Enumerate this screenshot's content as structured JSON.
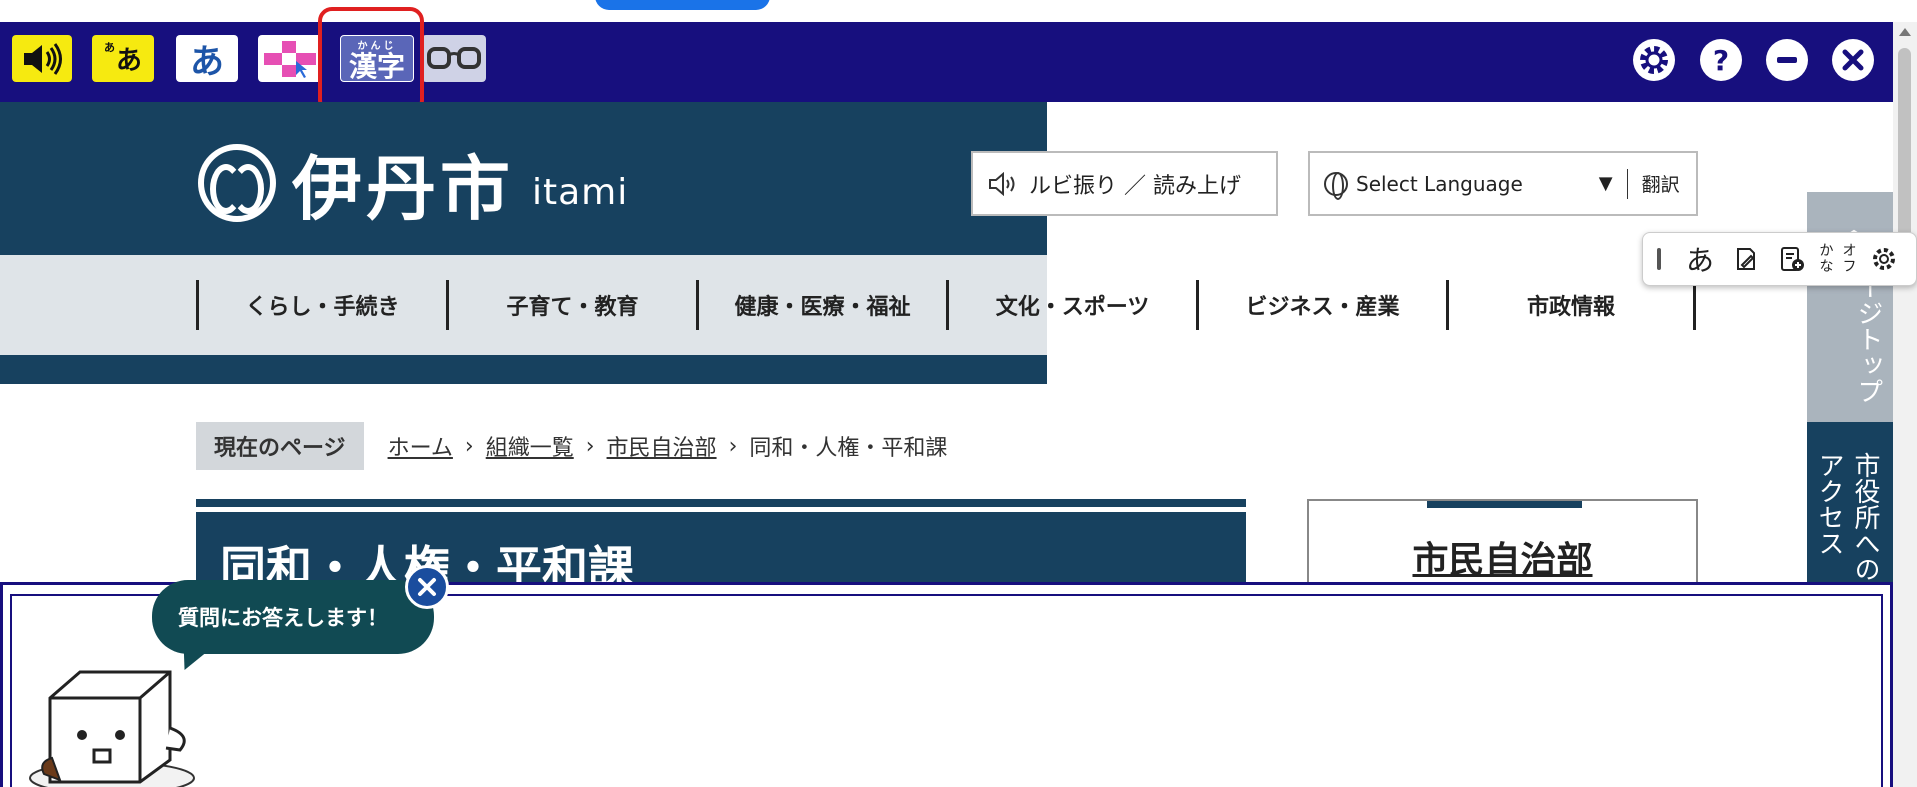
{
  "a11y_toolbar": {
    "ruby_tool": {
      "small": "あ",
      "main": "あ"
    },
    "kana_tool": "あ",
    "kanji_tool": {
      "ruby": "かんじ",
      "main": "漢字"
    },
    "help_label": "?",
    "colors": {
      "bar": "#170f7e",
      "tool_yellow": "#f6ea10",
      "highlight": "#e02020"
    }
  },
  "site": {
    "logo_text": "伊丹市",
    "logo_roman": "itami",
    "ruby_button_label": "ルビ振り ／ 読み上げ",
    "language_select": {
      "label": "Select Language",
      "translate": "翻訳"
    },
    "nav": [
      {
        "label": "くらし・手続き"
      },
      {
        "label": "子育て・教育"
      },
      {
        "label": "健康・医療・福祉"
      },
      {
        "label": "文化・スポーツ"
      },
      {
        "label": "ビジネス・産業"
      },
      {
        "label": "市政情報"
      }
    ],
    "pagetop_label": "ページトップへ",
    "access_label": "市役所へのアクセス"
  },
  "ime_toolbar": {
    "hiragana": "あ",
    "kana_off": {
      "line1": "かな",
      "line2": "オフ"
    }
  },
  "breadcrumb": {
    "current_label": "現在のページ",
    "links": [
      "ホーム",
      "組織一覧",
      "市民自治部"
    ],
    "current_page": "同和・人権・平和課"
  },
  "page": {
    "title": "同和・人権・平和課",
    "side_link": "市民自治部"
  },
  "chatbot": {
    "bubble_text": "質問にお答えします！"
  }
}
